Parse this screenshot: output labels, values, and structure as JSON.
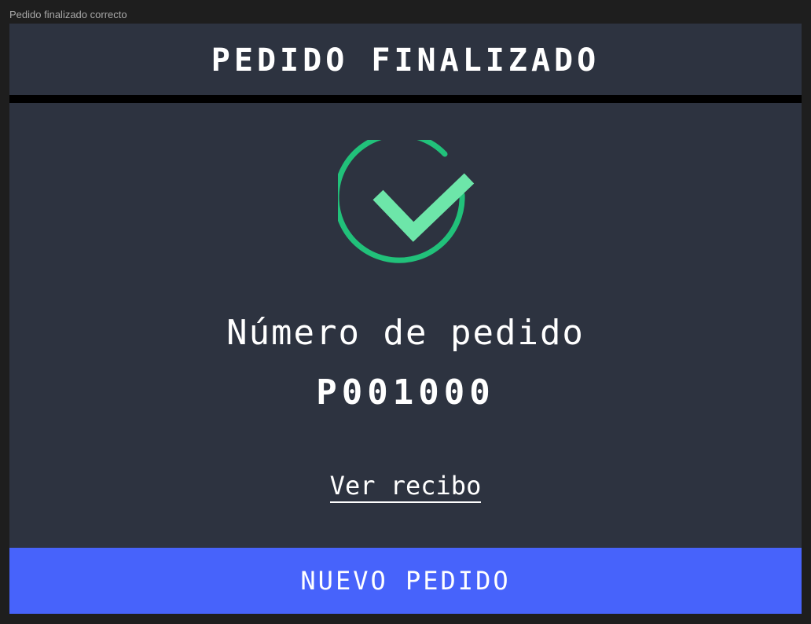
{
  "canvas": {
    "label": "Pedido finalizado correcto"
  },
  "header": {
    "title": "PEDIDO FINALIZADO"
  },
  "confirmation": {
    "icon": "check-circle-icon",
    "ring_color": "#21c17a",
    "check_color": "#6de6a9",
    "order_label": "Número de pedido",
    "order_number": "P001000"
  },
  "actions": {
    "receipt_link": "Ver recibo",
    "new_order_button": "NUEVO PEDIDO",
    "button_color": "#4763fb"
  },
  "colors": {
    "panel_background": "#2d3340",
    "divider": "#000000",
    "text": "#ffffff"
  }
}
